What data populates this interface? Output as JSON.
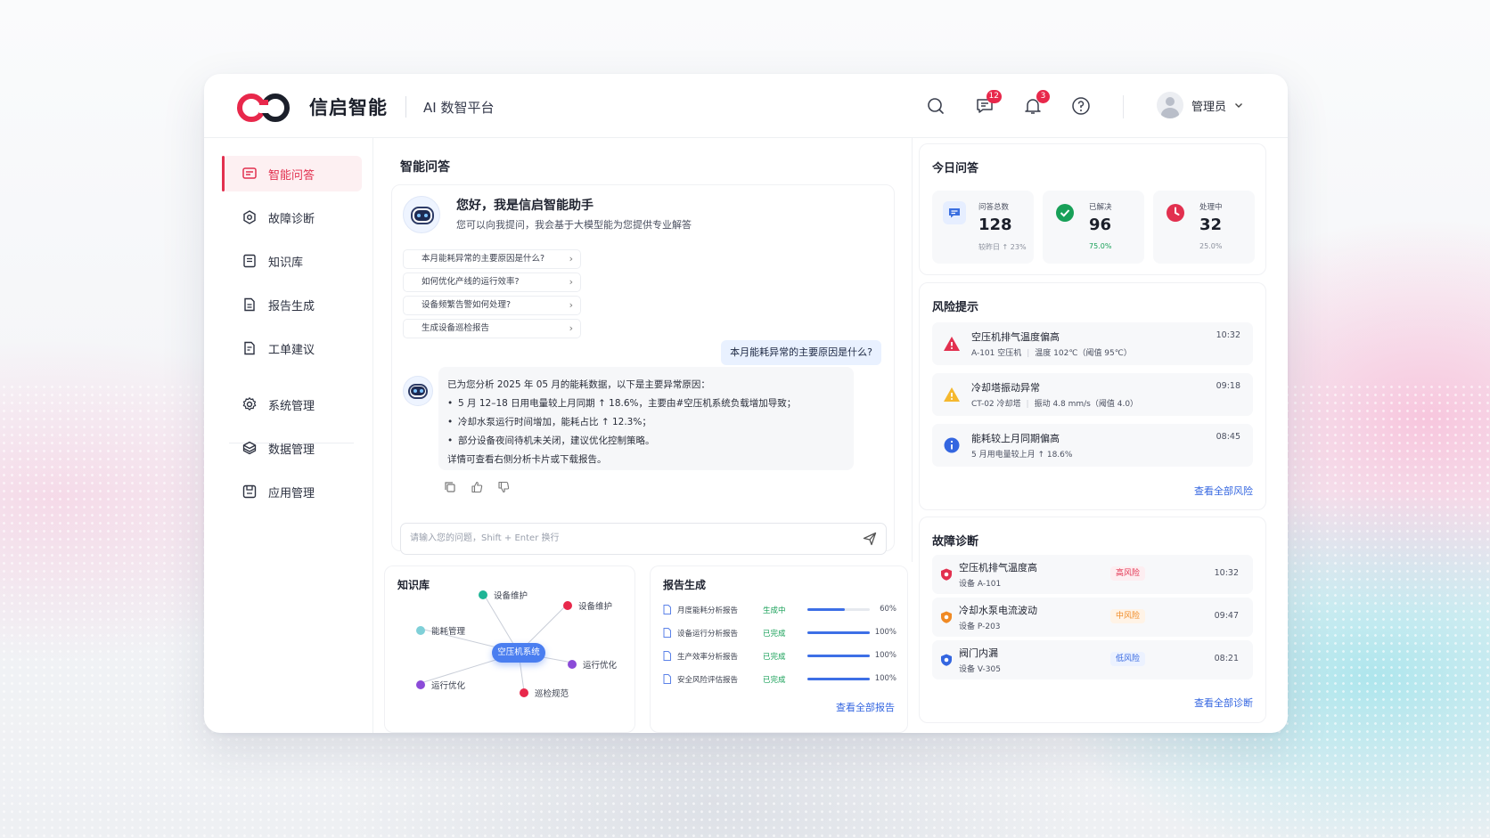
{
  "header": {
    "brand": "信启智能",
    "platform": "AI 数智平台",
    "messages_badge": "12",
    "notifications_badge": "3",
    "user_name": "管理员"
  },
  "sidebar": {
    "items": [
      {
        "label": "智能问答",
        "icon": "chat-icon"
      },
      {
        "label": "故障诊断",
        "icon": "diagnosis-icon"
      },
      {
        "label": "知识库",
        "icon": "book-icon"
      },
      {
        "label": "报告生成",
        "icon": "report-icon"
      },
      {
        "label": "工单建议",
        "icon": "ticket-icon"
      },
      {
        "label": "系统管理",
        "icon": "gear-icon"
      },
      {
        "label": "数据管理",
        "icon": "database-icon"
      },
      {
        "label": "应用管理",
        "icon": "apps-icon"
      }
    ]
  },
  "chat": {
    "title": "智能问答",
    "greeting_title": "您好，我是信启智能助手",
    "greeting_sub": "您可以向我提问，我会基于大模型能为您提供专业解答",
    "suggestions": [
      "本月能耗异常的主要原因是什么?",
      "如何优化产线的运行效率?",
      "设备频繁告警如何处理?",
      "生成设备巡检报告"
    ],
    "user_message": "本月能耗异常的主要原因是什么?",
    "answer": {
      "intro": "已为您分析 2025 年 05 月的能耗数据，以下是主要异常原因：",
      "bullets": [
        "5 月 12–18 日用电量较上月同期 ↑ 18.6%，主要由#空压机系统负载增加导致；",
        "冷却水泵运行时间增加，能耗占比 ↑ 12.3%；",
        "部分设备夜间待机未关闭，建议优化控制策略。"
      ],
      "footer": "详情可查看右侧分析卡片或下载报告。"
    },
    "input_placeholder": "请输入您的问题，Shift + Enter 换行"
  },
  "knowledge": {
    "title": "知识库",
    "center": "空压机系统",
    "nodes": [
      "设备维护",
      "设备维护",
      "能耗管理",
      "运行优化",
      "运行优化",
      "巡检规范"
    ]
  },
  "report": {
    "title": "报告生成",
    "rows": [
      {
        "name": "月度能耗分析报告",
        "status": "生成中",
        "progress": 60,
        "pct": "60%"
      },
      {
        "name": "设备运行分析报告",
        "status": "已完成",
        "progress": 100,
        "pct": "100%"
      },
      {
        "name": "生产效率分析报告",
        "status": "已完成",
        "progress": 100,
        "pct": "100%"
      },
      {
        "name": "安全风险评估报告",
        "status": "已完成",
        "progress": 100,
        "pct": "100%"
      }
    ],
    "link": "查看全部报告"
  },
  "today": {
    "title": "今日问答",
    "stats": [
      {
        "label": "问答总数",
        "value": "128",
        "sub": "较昨日 ↑ 23%",
        "color": "#3b6fe0"
      },
      {
        "label": "已解决",
        "value": "96",
        "sub": "75.0%",
        "color": "#18a058"
      },
      {
        "label": "处理中",
        "value": "32",
        "sub": "25.0%",
        "color": "#e2304f"
      }
    ]
  },
  "risk": {
    "title": "风险提示",
    "items": [
      {
        "title": "空压机排气温度偏高",
        "device": "A-101 空压机",
        "detail": "温度 102℃（阈值 95℃）",
        "time": "10:32",
        "level": "danger"
      },
      {
        "title": "冷却塔振动异常",
        "device": "CT-02 冷却塔",
        "detail": "振动 4.8 mm/s（阈值 4.0）",
        "time": "09:18",
        "level": "warning"
      },
      {
        "title": "能耗较上月同期偏高",
        "device": "5 月用电量较上月 ↑ 18.6%",
        "detail": "",
        "time": "08:45",
        "level": "info"
      }
    ],
    "link": "查看全部风险"
  },
  "fault": {
    "title": "故障诊断",
    "items": [
      {
        "title": "空压机排气温度高",
        "device": "设备 A-101",
        "level": "高风险",
        "time": "10:32",
        "color": "#e2304f",
        "bg": "#fdeef1"
      },
      {
        "title": "冷却水泵电流波动",
        "device": "设备 P-203",
        "level": "中风险",
        "time": "09:47",
        "color": "#f08a24",
        "bg": "#fff3e6"
      },
      {
        "title": "阀门内漏",
        "device": "设备 V-305",
        "level": "低风险",
        "time": "08:21",
        "color": "#3466e0",
        "bg": "#ecf2ff"
      }
    ],
    "link": "查看全部诊断"
  }
}
